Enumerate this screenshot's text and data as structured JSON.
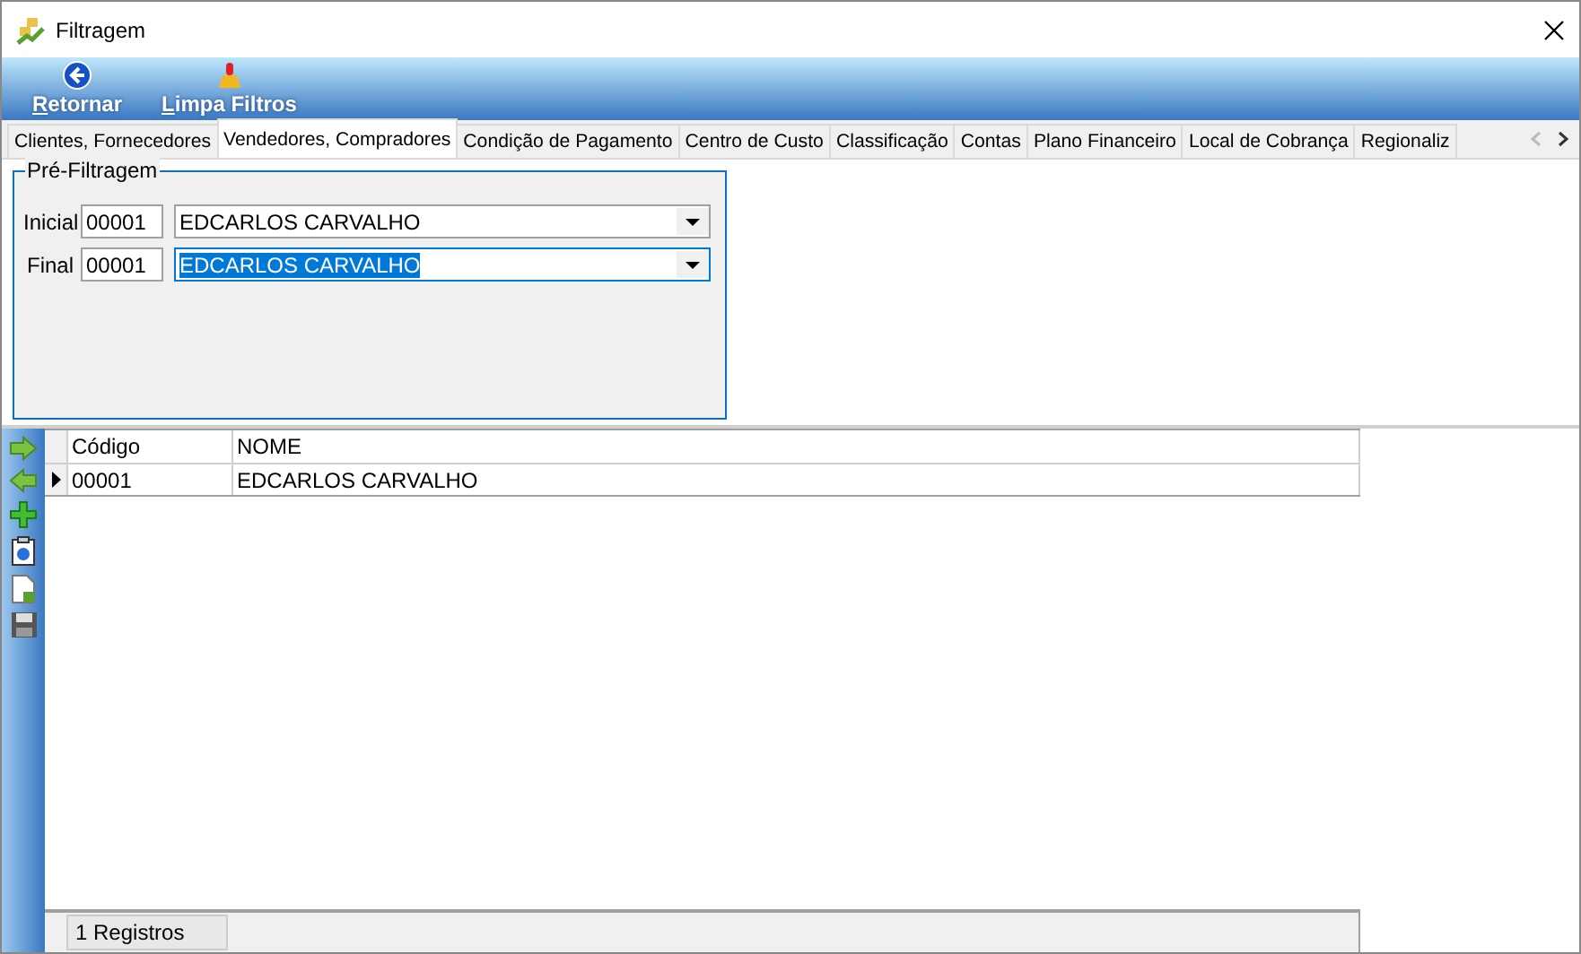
{
  "window": {
    "title": "Filtragem"
  },
  "toolbar": [
    {
      "kind": "back",
      "label": "Retornar"
    },
    {
      "kind": "clear",
      "label": "Limpa Filtros"
    }
  ],
  "tabs": [
    {
      "label": "Clientes, Fornecedores",
      "selected": false
    },
    {
      "label": "Vendedores, Compradores",
      "selected": true
    },
    {
      "label": "Condição de Pagamento",
      "selected": false
    },
    {
      "label": "Centro de Custo",
      "selected": false
    },
    {
      "label": "Classificação",
      "selected": false
    },
    {
      "label": "Contas",
      "selected": false
    },
    {
      "label": "Plano Financeiro",
      "selected": false
    },
    {
      "label": "Local de Cobrança",
      "selected": false
    },
    {
      "label": "Regionaliz",
      "selected": false
    }
  ],
  "prefilter": {
    "title": "Pré-Filtragem",
    "rows": [
      {
        "label": "Inicial",
        "code": "00001",
        "name": "EDCARLOS CARVALHO",
        "focused": false
      },
      {
        "label": "Final",
        "code": "00001",
        "name": "EDCARLOS CARVALHO",
        "focused": true
      }
    ]
  },
  "grid": {
    "columns": [
      "Código",
      "NOME"
    ],
    "rows": [
      {
        "cells": [
          "00001",
          "EDCARLOS CARVALHO"
        ],
        "selected": true
      }
    ]
  },
  "status_bar": "1 Registros"
}
